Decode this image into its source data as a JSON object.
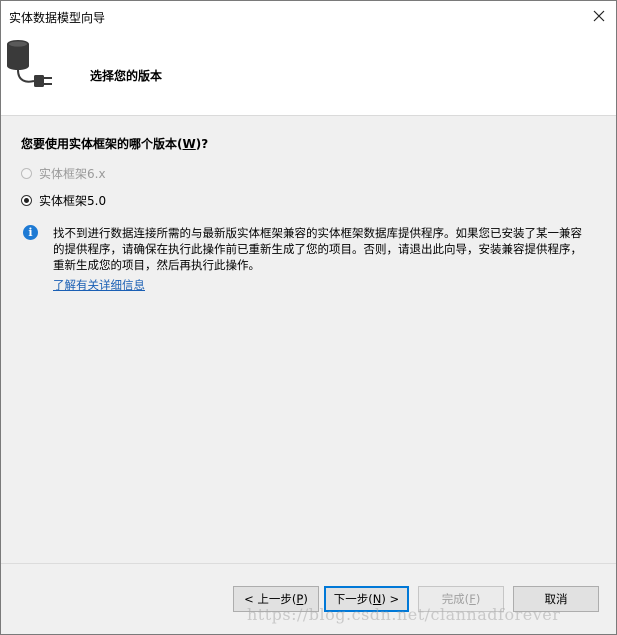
{
  "window": {
    "title": "实体数据模型向导"
  },
  "header": {
    "title": "选择您的版本"
  },
  "question": {
    "prefix": "您要使用实体框架的哪个版本(",
    "accesskey": "W",
    "suffix": ")?"
  },
  "options": [
    {
      "label": "实体框架6.x",
      "checked": false,
      "disabled": true
    },
    {
      "label": "实体框架5.0",
      "checked": true,
      "disabled": false
    }
  ],
  "info": {
    "text": "找不到进行数据连接所需的与最新版实体框架兼容的实体框架数据库提供程序。如果您已安装了某一兼容的提供程序，请确保在执行此操作前已重新生成了您的项目。否则，请退出此向导，安装兼容提供程序，重新生成您的项目，然后再执行此操作。",
    "link": "了解有关详细信息"
  },
  "buttons": {
    "back": {
      "prefix": "< 上一步(",
      "key": "P",
      "suffix": ")"
    },
    "next": {
      "prefix": "下一步(",
      "key": "N",
      "suffix": ") >"
    },
    "finish": {
      "prefix": "完成(",
      "key": "F",
      "suffix": ")"
    },
    "cancel": {
      "label": "取消"
    }
  },
  "watermark": "https://blog.csdn.net/clannadforever",
  "colors": {
    "accent": "#0078d7",
    "info": "#1e7ad4",
    "link": "#1a5fb4"
  }
}
